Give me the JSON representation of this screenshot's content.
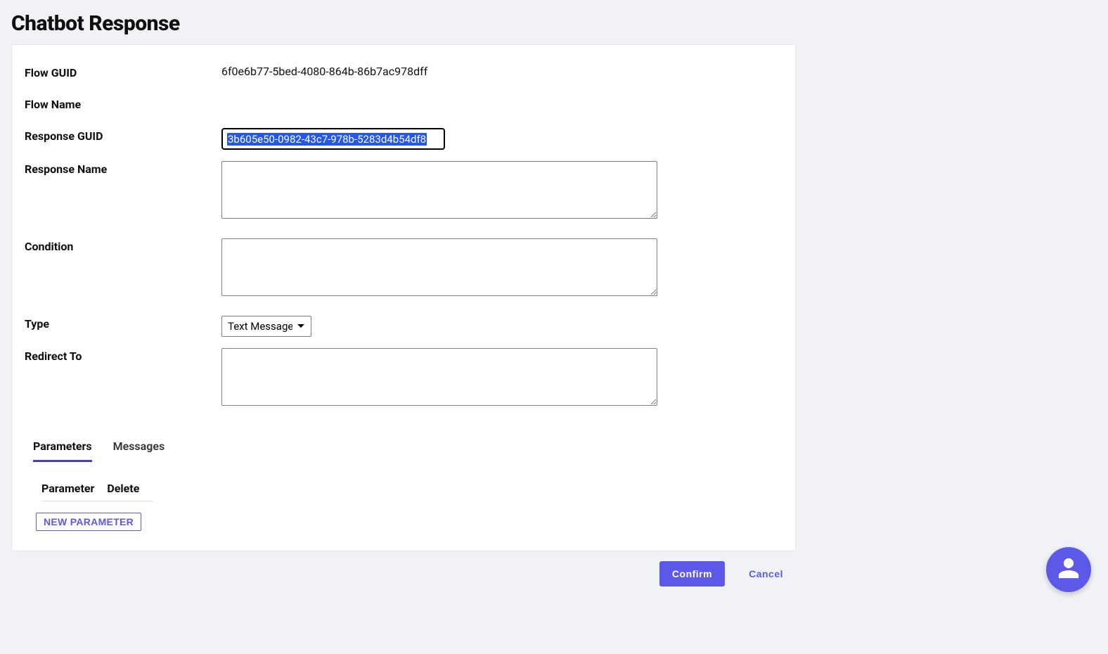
{
  "title": "Chatbot Response",
  "fields": {
    "flow_guid": {
      "label": "Flow GUID",
      "value": "6f0e6b77-5bed-4080-864b-86b7ac978dff"
    },
    "flow_name": {
      "label": "Flow Name",
      "value": ""
    },
    "response_guid": {
      "label": "Response GUID",
      "value": "3b605e50-0982-43c7-978b-5283d4b54df8"
    },
    "response_name": {
      "label": "Response Name",
      "value": ""
    },
    "condition": {
      "label": "Condition",
      "value": ""
    },
    "type": {
      "label": "Type",
      "selected": "Text Message"
    },
    "redirect_to": {
      "label": "Redirect To",
      "value": ""
    }
  },
  "tabs": [
    {
      "label": "Parameters",
      "active": true
    },
    {
      "label": "Messages",
      "active": false
    }
  ],
  "parameters_table": {
    "columns": [
      "Parameter",
      "Delete"
    ],
    "new_button": "New Parameter"
  },
  "actions": {
    "confirm": "Confirm",
    "cancel": "Cancel"
  },
  "fab_icon": "person-icon"
}
